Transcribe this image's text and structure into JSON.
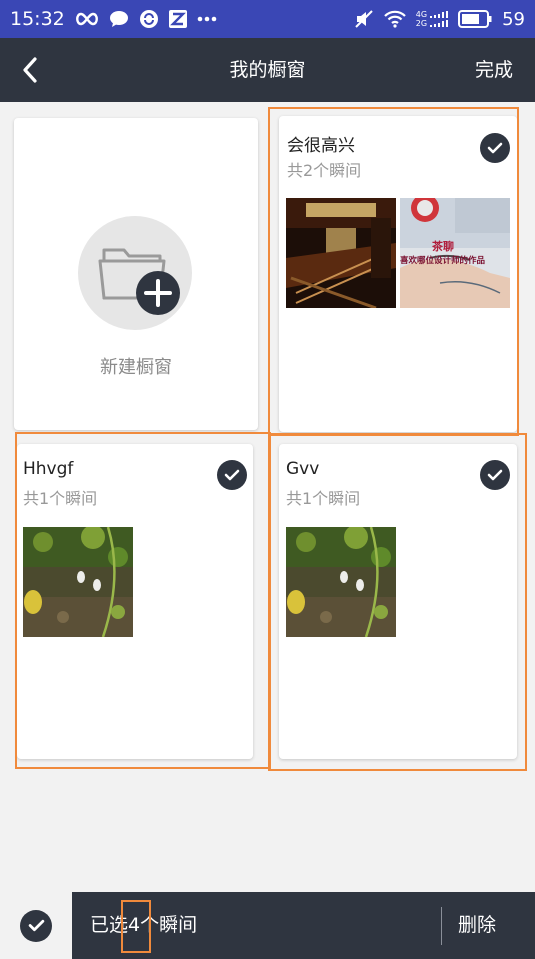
{
  "status_bar": {
    "time": "15:32",
    "battery": "59",
    "network_labels": [
      "4G",
      "2G"
    ],
    "left_icons": [
      "infinity-icon",
      "chat-bubble-icon",
      "sync-icon",
      "z-app-icon",
      "more-dots-icon"
    ],
    "right_icons": [
      "mute-icon",
      "wifi-icon",
      "signal-icon",
      "battery-icon"
    ]
  },
  "toolbar": {
    "title": "我的橱窗",
    "done_label": "完成"
  },
  "new_window": {
    "label": "新建橱窗"
  },
  "windows": [
    {
      "title": "会很高兴",
      "count_label": "共2个瞬间",
      "selected": true,
      "images": [
        "interior-photo",
        "tattoo-studio-photo"
      ]
    },
    {
      "title": "Hhvgf",
      "count_label": "共1个瞬间",
      "selected": true,
      "images": [
        "plants-photo"
      ]
    },
    {
      "title": "Gvv",
      "count_label": "共1个瞬间",
      "selected": true,
      "images": [
        "plants-photo"
      ]
    }
  ],
  "thumb_overlay_text": [
    "茶聊",
    "喜欢哪位设计师的作品"
  ],
  "bottom_bar": {
    "selected_prefix": "已选",
    "selected_count": "4",
    "selected_suffix": "个瞬间",
    "delete_label": "删除"
  },
  "colors": {
    "status_bar": "#3a47b5",
    "toolbar": "#2f3540",
    "highlight": "#f08a3c",
    "check_bg": "#2f3540"
  }
}
